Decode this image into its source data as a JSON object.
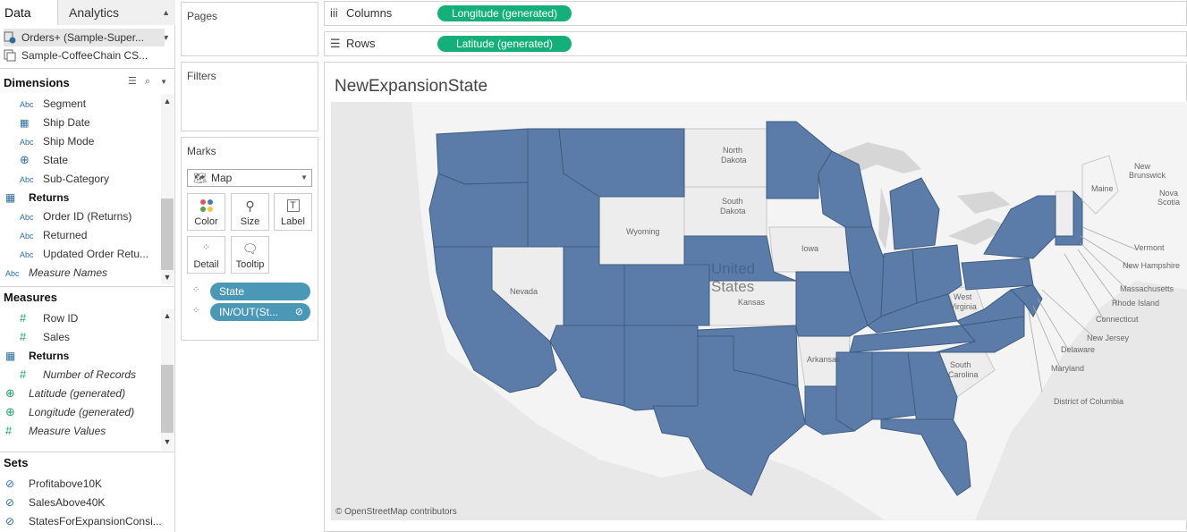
{
  "tabs": {
    "data": "Data",
    "analytics": "Analytics"
  },
  "datasources": [
    {
      "label": "Orders+ (Sample-Super..."
    },
    {
      "label": "Sample-CoffeeChain CS..."
    }
  ],
  "dimensions": {
    "header": "Dimensions",
    "items": [
      {
        "label": "Segment",
        "icon": "Abc"
      },
      {
        "label": "Ship Date",
        "icon": "calendar-icon"
      },
      {
        "label": "Ship Mode",
        "icon": "Abc"
      },
      {
        "label": "State",
        "icon": "globe-icon"
      },
      {
        "label": "Sub-Category",
        "icon": "Abc"
      },
      {
        "label": "Returns",
        "icon": "table-icon"
      },
      {
        "label": "Order ID (Returns)",
        "icon": "Abc"
      },
      {
        "label": "Returned",
        "icon": "Abc"
      },
      {
        "label": "Updated Order Retu...",
        "icon": "Abc"
      },
      {
        "label": "Measure Names",
        "icon": "Abc"
      }
    ]
  },
  "measures": {
    "header": "Measures",
    "items": [
      {
        "label": "Row ID",
        "icon": "#"
      },
      {
        "label": "Sales",
        "icon": "#"
      },
      {
        "label": "Returns",
        "icon": "table-icon"
      },
      {
        "label": "Number of Records",
        "icon": "#"
      },
      {
        "label": "Latitude (generated)",
        "icon": "globe-icon"
      },
      {
        "label": "Longitude (generated)",
        "icon": "globe-icon"
      },
      {
        "label": "Measure Values",
        "icon": "#"
      }
    ]
  },
  "sets": {
    "header": "Sets",
    "items": [
      {
        "label": "Profitabove10K"
      },
      {
        "label": "SalesAbove40K"
      },
      {
        "label": "StatesForExpansionConsi..."
      }
    ]
  },
  "cards": {
    "pages": "Pages",
    "filters": "Filters",
    "marks": "Marks",
    "mark_type": "Map",
    "buttons": [
      "Color",
      "Size",
      "Label",
      "Detail",
      "Tooltip"
    ],
    "pills": [
      "State",
      "IN/OUT(St..."
    ]
  },
  "shelves": {
    "columns_label": "Columns",
    "columns_pill": "Longitude (generated)",
    "rows_label": "Rows",
    "rows_pill": "Latitude (generated)"
  },
  "view": {
    "title": "NewExpansionState",
    "attribution": "© OpenStreetMap contributors",
    "watermark": [
      "United",
      "States"
    ]
  },
  "map_labels": {
    "north_dakota": [
      "North",
      "Dakota"
    ],
    "south_dakota": [
      "South",
      "Dakota"
    ],
    "wyoming": "Wyoming",
    "nevada": "Nevada",
    "iowa": "Iowa",
    "kansas": "Kansas",
    "arkansas": "Arkansas",
    "south_carolina": [
      "South",
      "Carolina"
    ],
    "west_virginia": [
      "West",
      "Virginia"
    ],
    "maine": "Maine",
    "new_brunswick": [
      "New",
      "Brunswick"
    ],
    "nova_scotia": [
      "Nova",
      "Scotia"
    ],
    "callouts": [
      "Vermont",
      "New Hampshire",
      "Massachusetts",
      "Rhode Island",
      "Connecticut",
      "New Jersey",
      "Delaware",
      "Maryland",
      "District of Columbia"
    ]
  },
  "colors": {
    "state_in": "#5b7ca8",
    "state_out": "#ededed",
    "sea": "#e8e8e8",
    "shelf_pill": "#15b07a",
    "marks_pill": "#4b98b6"
  }
}
